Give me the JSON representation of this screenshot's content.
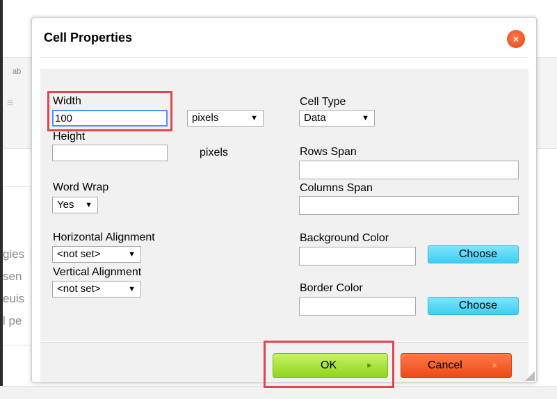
{
  "dialog": {
    "title": "Cell Properties",
    "close_icon": "×"
  },
  "background": {
    "toolbar_glyph": "ab",
    "fragments": [
      "gies",
      "sen",
      "euis",
      "l pe"
    ]
  },
  "fields": {
    "width": {
      "label": "Width",
      "value": "100",
      "unit_selected": "pixels"
    },
    "height": {
      "label": "Height",
      "value": "",
      "unit_text": "pixels"
    },
    "word_wrap": {
      "label": "Word Wrap",
      "selected": "Yes"
    },
    "horizontal_alignment": {
      "label": "Horizontal Alignment",
      "selected": "<not set>"
    },
    "vertical_alignment": {
      "label": "Vertical Alignment",
      "selected": "<not set>"
    },
    "cell_type": {
      "label": "Cell Type",
      "selected": "Data"
    },
    "rows_span": {
      "label": "Rows Span",
      "value": ""
    },
    "columns_span": {
      "label": "Columns Span",
      "value": ""
    },
    "background_color": {
      "label": "Background Color",
      "value": "",
      "button": "Choose"
    },
    "border_color": {
      "label": "Border Color",
      "value": "",
      "button": "Choose"
    }
  },
  "footer": {
    "ok_label": "OK",
    "ok_arrow": "►",
    "cancel_label": "Cancel",
    "cancel_icon": "×"
  },
  "icons": {
    "dropdown": "▼"
  },
  "colors": {
    "ok": "#8fd31a",
    "cancel": "#ea4a15",
    "choose": "#3fcdf2",
    "highlight": "#e0474c"
  }
}
